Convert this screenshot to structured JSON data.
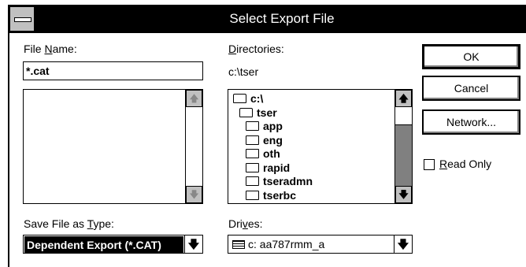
{
  "window": {
    "title": "Select Export File"
  },
  "file_name": {
    "label_pre": "File ",
    "label_hot": "N",
    "label_post": "ame:",
    "value": "*.cat",
    "list_items": []
  },
  "directories": {
    "label_hot": "D",
    "label_post": "irectories:",
    "current_path": "c:\\tser",
    "items": [
      {
        "name": "c:\\",
        "icon": "folder-open-icon"
      },
      {
        "name": "tser",
        "icon": "folder-open-icon"
      },
      {
        "name": "app",
        "icon": "folder-icon"
      },
      {
        "name": "eng",
        "icon": "folder-icon"
      },
      {
        "name": "oth",
        "icon": "folder-icon"
      },
      {
        "name": "rapid",
        "icon": "folder-icon"
      },
      {
        "name": "tseradmn",
        "icon": "folder-icon"
      },
      {
        "name": "tserbc",
        "icon": "folder-icon"
      }
    ]
  },
  "buttons": {
    "ok": "OK",
    "cancel": "Cancel",
    "network": "Network..."
  },
  "read_only": {
    "label_hot": "R",
    "label_post": "ead Only",
    "checked": false
  },
  "save_type": {
    "label_pre": "Save File as ",
    "label_hot": "T",
    "label_post": "ype:",
    "selected": "Dependent Export (*.CAT)"
  },
  "drives": {
    "label_pre": "Dri",
    "label_hot": "v",
    "label_post": "es:",
    "selected": "c: aa787rmm_a"
  },
  "glyphs": {
    "arrow_up": "🡅",
    "arrow_down": "🡇"
  }
}
